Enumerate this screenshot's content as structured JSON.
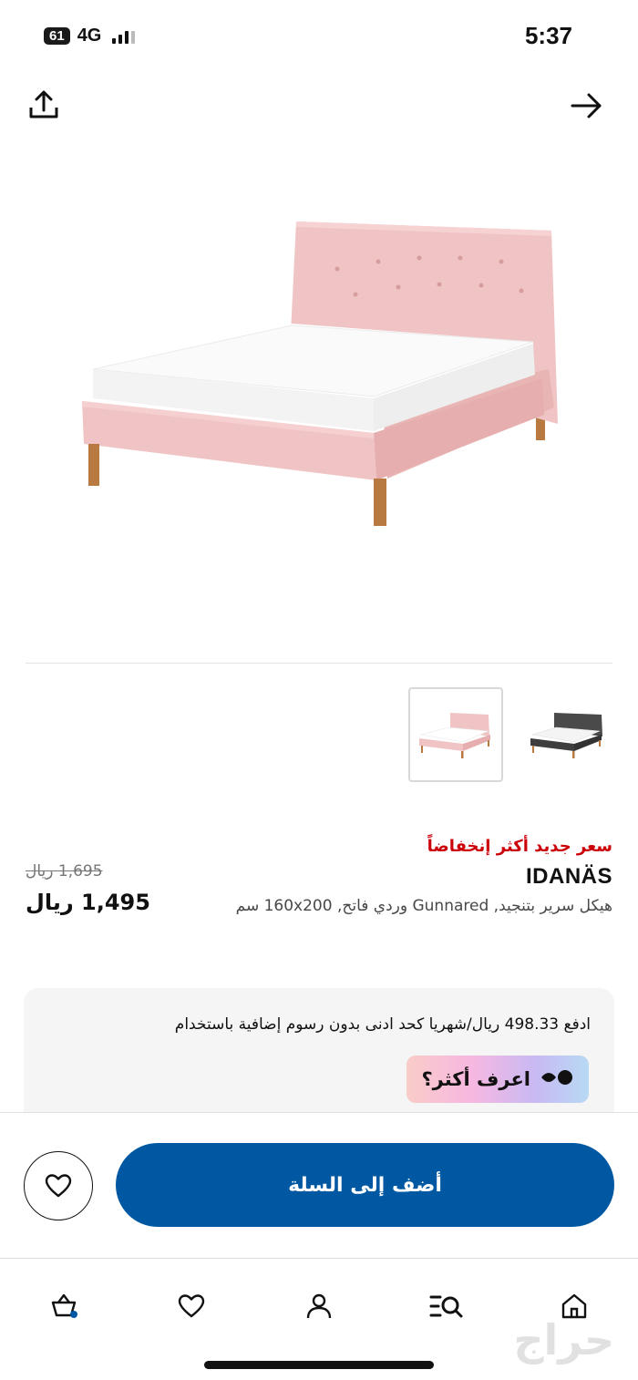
{
  "status_bar": {
    "battery": "61",
    "network": "4G",
    "time": "5:37"
  },
  "header": {
    "share_icon": "share-icon",
    "forward_icon": "arrow-right-icon"
  },
  "product": {
    "image_icon": "upholstered-bed-pink",
    "badge": "سعر جديد أكثر إنخفاضاً",
    "name": "IDANÄS",
    "description": "هيكل سرير بتنجيد, Gunnared وردي فاتح, 160x200 سم",
    "old_price": "1,695 ريال",
    "new_price": "1,495 ريال",
    "thumbnails": [
      {
        "name": "pink",
        "selected": true
      },
      {
        "name": "dark-grey",
        "selected": false
      }
    ]
  },
  "installment": {
    "text": "ادفع 498.33 ريال/شهريا كحد ادنى بدون رسوم إضافية باستخدام",
    "learn_more": "اعرف أكثر؟",
    "brand_icon": "tabby-icon"
  },
  "actions": {
    "favorite_icon": "heart-icon",
    "add_to_cart": "أضف إلى السلة"
  },
  "tab_bar": {
    "items": [
      "home",
      "search",
      "profile",
      "favorites",
      "cart"
    ]
  },
  "watermark": "حراج",
  "colors": {
    "primary": "#0058a3",
    "sale_red": "#cc0008",
    "card_bg": "#f5f5f5",
    "bed_pink": "#f0c4c4"
  }
}
